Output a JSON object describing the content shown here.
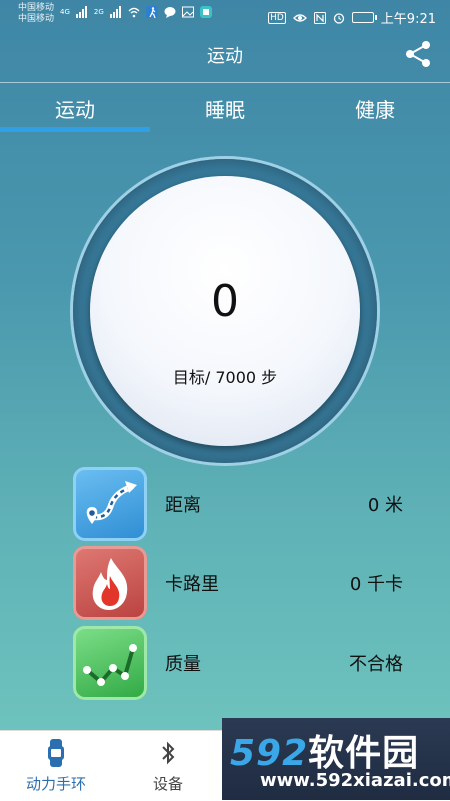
{
  "status_bar": {
    "carrier1": "中国移动",
    "carrier2": "中国移动",
    "time": "上午9:21",
    "hd_label": "HD",
    "network1": "4G",
    "network2": "2G"
  },
  "app_bar": {
    "title": "运动"
  },
  "tabs": [
    {
      "label": "运动",
      "active": true
    },
    {
      "label": "睡眠",
      "active": false
    },
    {
      "label": "健康",
      "active": false
    }
  ],
  "dial": {
    "steps": "0",
    "goal_prefix": "目标/",
    "goal_value": "7000",
    "goal_unit": "步"
  },
  "stats": [
    {
      "label": "距离",
      "value": "0 米",
      "icon": "route-icon",
      "color": "#3c9fe0"
    },
    {
      "label": "卡路里",
      "value": "0 千卡",
      "icon": "flame-icon",
      "color": "#c9524f"
    },
    {
      "label": "质量",
      "value": "不合格",
      "icon": "quality-chart-icon",
      "color": "#37b84f"
    }
  ],
  "bottom_nav": [
    {
      "label": "动力手环",
      "icon": "band-icon",
      "active": true
    },
    {
      "label": "设备",
      "icon": "bluetooth-icon",
      "active": false
    }
  ],
  "watermark": {
    "brand_num": "592",
    "brand_text": "软件园",
    "url": "www.592xiazai.com"
  }
}
